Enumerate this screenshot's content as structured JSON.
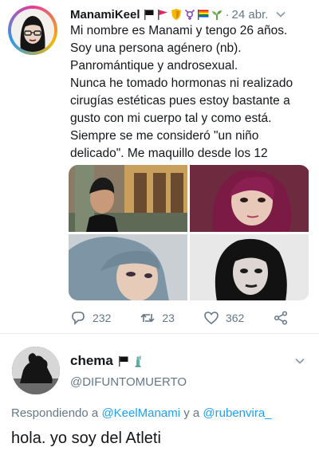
{
  "tweet": {
    "name": "ManamiKeel",
    "time": "24 abr.",
    "text": "Mi nombre es Manami y tengo 26 años.\nSoy una persona agénero (nb).\nPanromántique y androsexual.\nNunca he tomado hormonas ni realizado\ncirugías estéticas pues estoy bastante a\ngusto con mi cuerpo tal y como está.\nSiempre se me consideró \"un niño\ndelicado\". Me maquillo desde los 12",
    "counts": {
      "replies": "232",
      "retweets": "23",
      "likes": "362"
    }
  },
  "reply": {
    "name": "chema",
    "handle": "@DIFUNTOMUERTO",
    "replying_prefix": "Respondiendo a",
    "mention1": "@KeelManami",
    "connector": "y a",
    "mention2": "@rubenvira_",
    "text": "hola. yo soy del Atleti"
  },
  "colors": {
    "link": "#1da1f2",
    "muted": "#657786",
    "text": "#14171a"
  }
}
